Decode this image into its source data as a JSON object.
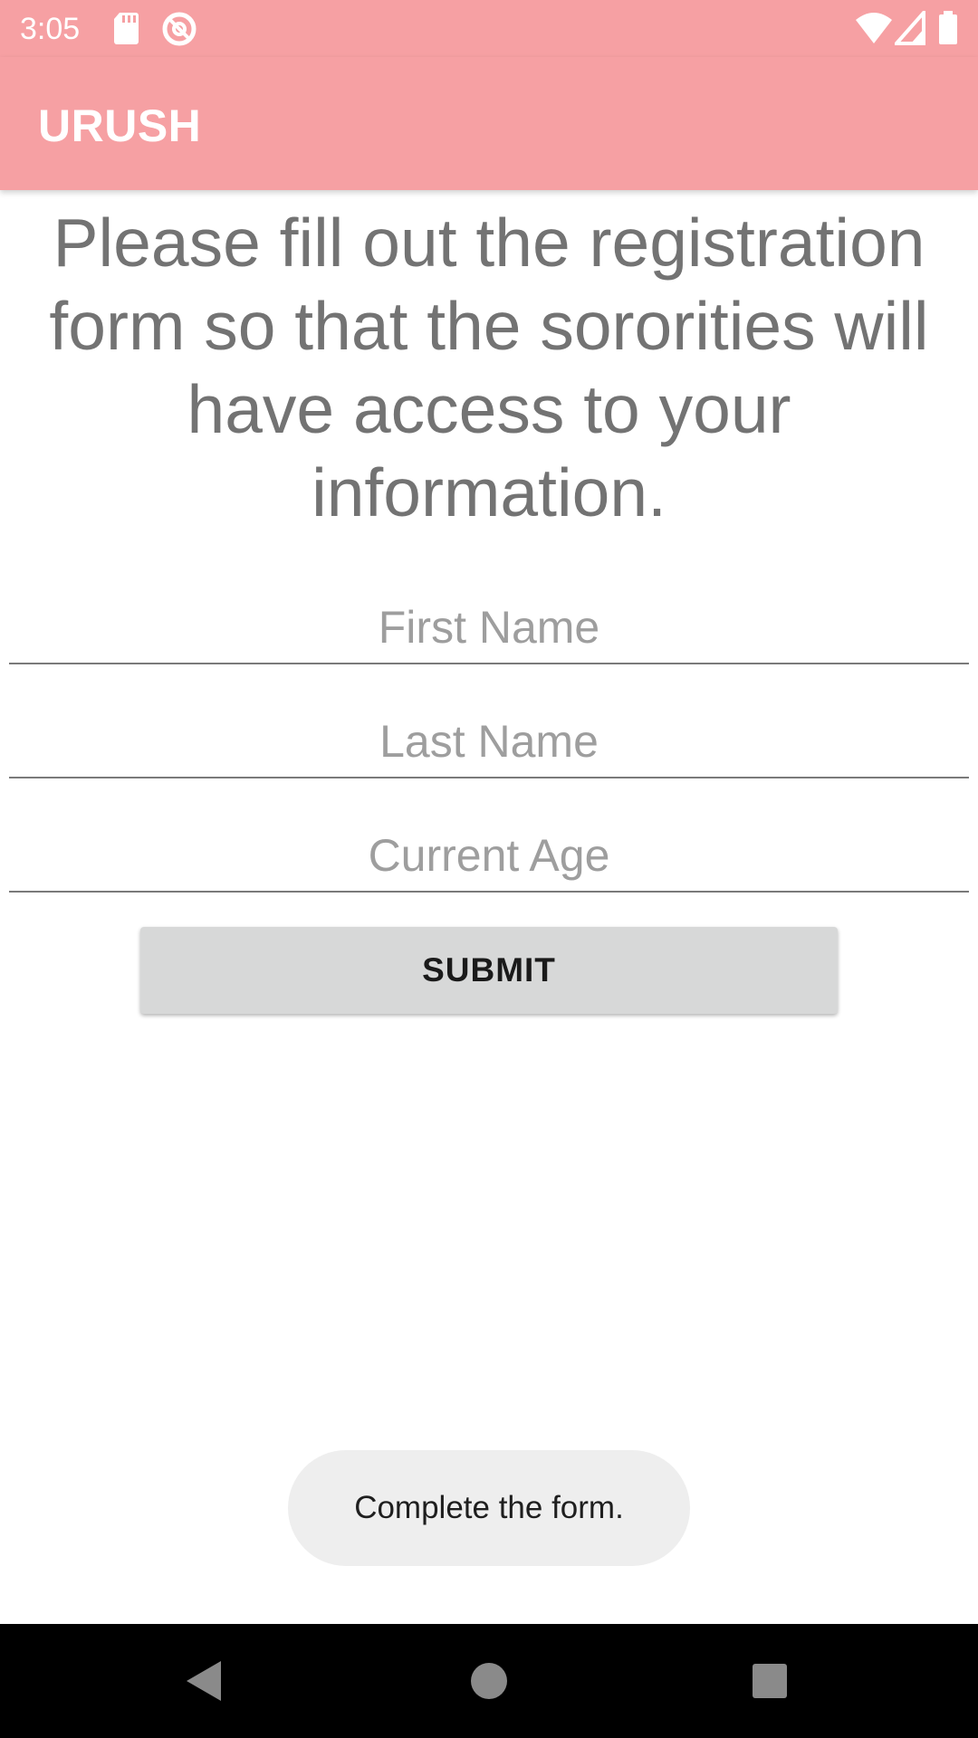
{
  "status_bar": {
    "time": "3:05",
    "icons": [
      "sd-card-icon",
      "sync-blocked-icon",
      "wifi-icon",
      "cellular-signal-icon",
      "battery-icon"
    ]
  },
  "app_bar": {
    "title": "URUSH"
  },
  "main": {
    "intro": "Please fill out the registration form so that the sororities will have access to your information.",
    "fields": [
      {
        "placeholder": "First Name",
        "value": ""
      },
      {
        "placeholder": "Last Name",
        "value": ""
      },
      {
        "placeholder": "Current Age",
        "value": ""
      }
    ],
    "submit_label": "SUBMIT"
  },
  "toast": {
    "message": "Complete the form."
  },
  "nav_bar": {
    "buttons": [
      "back-icon",
      "home-icon",
      "recents-icon"
    ]
  },
  "colors": {
    "app_bar": "#f6a0a3",
    "button": "#d7d8d8",
    "text": "#737373"
  }
}
